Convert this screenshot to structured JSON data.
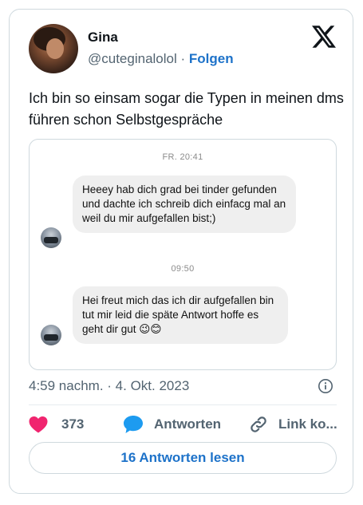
{
  "author": {
    "name": "Gina",
    "handle": "@cuteginalolol",
    "separator": " · ",
    "follow_label": "Folgen"
  },
  "tweet": {
    "text": "Ich bin so einsam sogar die Typen in meinen dms führen schon Selbstgespräche"
  },
  "dm_screenshot": {
    "timestamp_1": "FR. 20:41",
    "message_1": "Heeey hab dich grad bei tinder gefunden und dachte ich schreib dich einfacg mal an weil du mir aufgefallen bist;)",
    "timestamp_2": "09:50",
    "message_2": "Hei freut mich das ich dir aufgefallen bin tut mir leid die späte Antwort hoffe es geht dir gut 😉😊"
  },
  "meta": {
    "posted": "4:59 nachm. · 4. Okt. 2023"
  },
  "actions": {
    "like_count": "373",
    "reply_label": "Antworten",
    "link_label": "Link ko..."
  },
  "read_replies_label": "16 Antworten lesen",
  "colors": {
    "like": "#f0256f",
    "reply": "#1d9bf0",
    "accent_link": "#1d72c9",
    "muted": "#536471"
  },
  "icons": {
    "brand": "x-logo-icon",
    "info": "info-icon",
    "like": "heart-icon",
    "reply": "speech-bubble-icon",
    "link": "link-icon"
  }
}
